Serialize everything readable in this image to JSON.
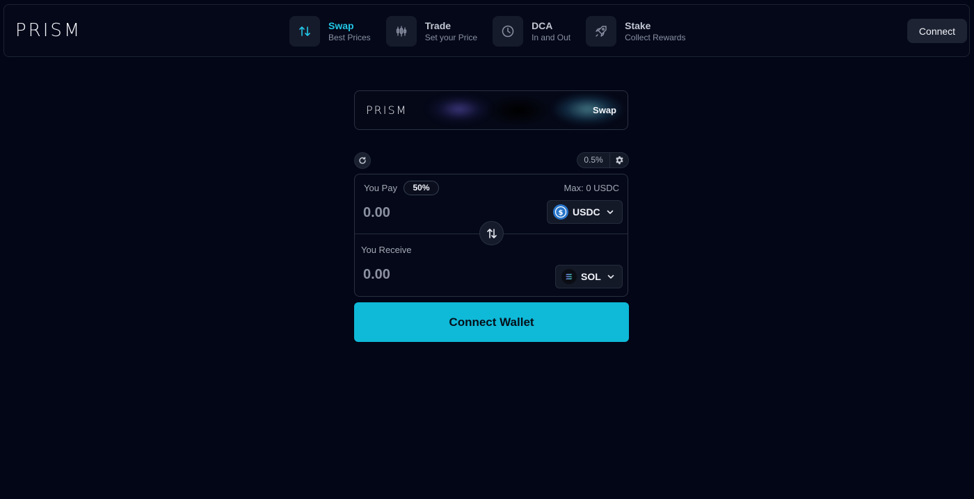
{
  "header": {
    "logo": "PRISM",
    "connect_label": "Connect",
    "nav": [
      {
        "title": "Swap",
        "subtitle": "Best Prices",
        "icon": "swap-arrows-icon",
        "active": true
      },
      {
        "title": "Trade",
        "subtitle": "Set your Price",
        "icon": "candlestick-icon"
      },
      {
        "title": "DCA",
        "subtitle": "In and Out",
        "icon": "clock-icon"
      },
      {
        "title": "Stake",
        "subtitle": "Collect Rewards",
        "icon": "rocket-icon"
      }
    ]
  },
  "banner": {
    "logo": "PRISM",
    "label": "Swap"
  },
  "controls": {
    "slippage": "0.5%"
  },
  "swap": {
    "pay": {
      "label": "You Pay",
      "percent_chip": "50%",
      "max": "Max: 0 USDC",
      "placeholder": "0.00",
      "token": "USDC"
    },
    "receive": {
      "label": "You Receive",
      "placeholder": "0.00",
      "token": "SOL"
    }
  },
  "action": {
    "label": "Connect Wallet"
  },
  "colors": {
    "background": "#030616",
    "accent": "#0fb9d8",
    "active_nav": "#22c7e6",
    "panel": "#141928"
  }
}
